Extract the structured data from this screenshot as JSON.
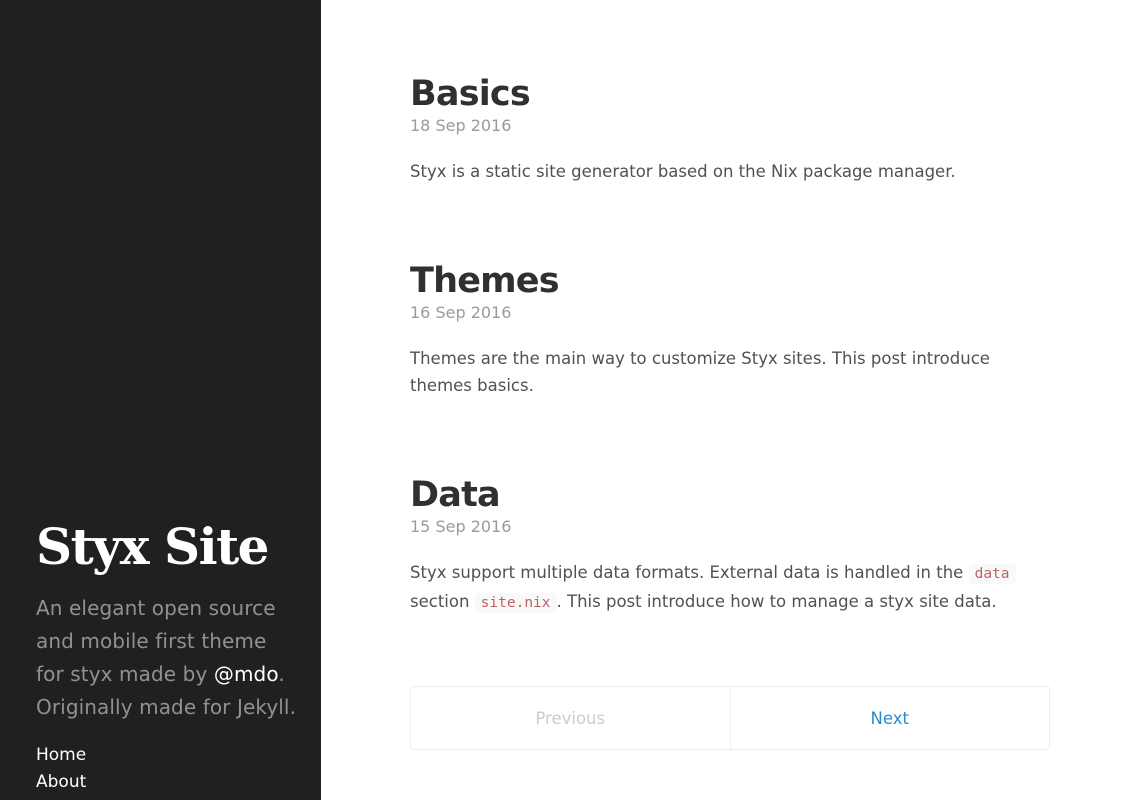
{
  "sidebar": {
    "title": "Styx Site",
    "lead_prefix": "An elegant open source and mobile first theme for styx made by ",
    "lead_link": "@mdo",
    "lead_suffix": ". Originally made for Jekyll.",
    "nav": [
      {
        "label": "Home"
      },
      {
        "label": "About"
      }
    ]
  },
  "posts": [
    {
      "title": "Basics",
      "date": "18 Sep 2016",
      "excerpt": "Styx is a static site generator based on the Nix package manager."
    },
    {
      "title": "Themes",
      "date": "16 Sep 2016",
      "excerpt": "Themes are the main way to customize Styx sites. This post introduce themes basics."
    },
    {
      "title": "Data",
      "date": "15 Sep 2016",
      "excerpt_part1": "Styx support multiple data formats. External data is handled in the ",
      "code1": "data",
      "excerpt_part2": " section ",
      "code2": "site.nix",
      "excerpt_part3": ". This post introduce how to manage a styx site data."
    }
  ],
  "pagination": {
    "previous": "Previous",
    "next": "Next"
  },
  "colors": {
    "sidebar_bg": "#202020",
    "link_blue": "#268bd2",
    "code_red": "#bf616a"
  }
}
